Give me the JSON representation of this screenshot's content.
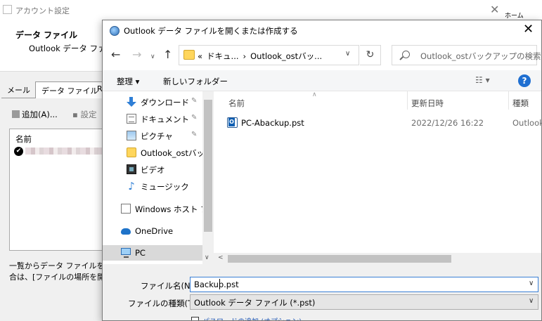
{
  "background_window": {
    "title": "アカウント設定",
    "heading": "データ ファイル",
    "subheading": "Outlook データ ファイ",
    "tabs": [
      "メール",
      "データ ファイル",
      "R"
    ],
    "add_label": "追加(A)...",
    "settings_label": "設定",
    "list_header": "名前",
    "note_line1": "一覧からデータ ファイルを選",
    "note_line2": "合は、[ファイルの場所を開く",
    "top_right_text": "ホーム"
  },
  "dialog": {
    "title": "Outlook データ ファイルを開くまたは作成する",
    "close_glyph": "✕",
    "nav": {
      "back_glyph": "←",
      "forward_glyph": "→",
      "recent_glyph": "∨",
      "up_glyph": "↑"
    },
    "address": {
      "prefix": "«",
      "segments": [
        "ドキュ...",
        "Outlook_ostバッ..."
      ],
      "separator": "›",
      "dropdown_glyph": "∨",
      "refresh_glyph": "↻"
    },
    "search": {
      "placeholder": "Outlook_ostバックアップの検索"
    },
    "toolbar": {
      "organize": "整理 ▾",
      "new_folder": "新しいフォルダー",
      "view_glyph": "☷ ▾",
      "help_glyph": "?"
    },
    "nav_pane": {
      "items": [
        {
          "label": "ダウンロード",
          "icon": "download-icon",
          "pinned": true
        },
        {
          "label": "ドキュメント",
          "icon": "document-icon",
          "pinned": true
        },
        {
          "label": "ピクチャ",
          "icon": "pictures-icon",
          "pinned": true
        },
        {
          "label": "Outlook_ostバック",
          "icon": "folder-icon",
          "pinned": false
        },
        {
          "label": "ビデオ",
          "icon": "video-icon",
          "pinned": false
        },
        {
          "label": "ミュージック",
          "icon": "music-icon",
          "pinned": false
        },
        {
          "label": "Windows ホスト プロ",
          "icon": "host-icon",
          "pinned": false
        },
        {
          "label": "OneDrive",
          "icon": "onedrive-icon",
          "pinned": false
        },
        {
          "label": "PC",
          "icon": "pc-icon",
          "pinned": false
        }
      ],
      "pin_glyph": "📌"
    },
    "file_list": {
      "columns": [
        "名前",
        "更新日時",
        "種類"
      ],
      "files": [
        {
          "name": "PC-Abackup.pst",
          "modified": "2022/12/26 16:22",
          "type": "Outlook"
        }
      ]
    },
    "form": {
      "filename_label": "ファイル名(N):",
      "filename_value": "Backup.pst",
      "filetype_label": "ファイルの種類(T):",
      "filetype_value": "Outlook データ ファイル (*.pst)",
      "password_label": "パスワードの追加 (オプション)"
    }
  }
}
